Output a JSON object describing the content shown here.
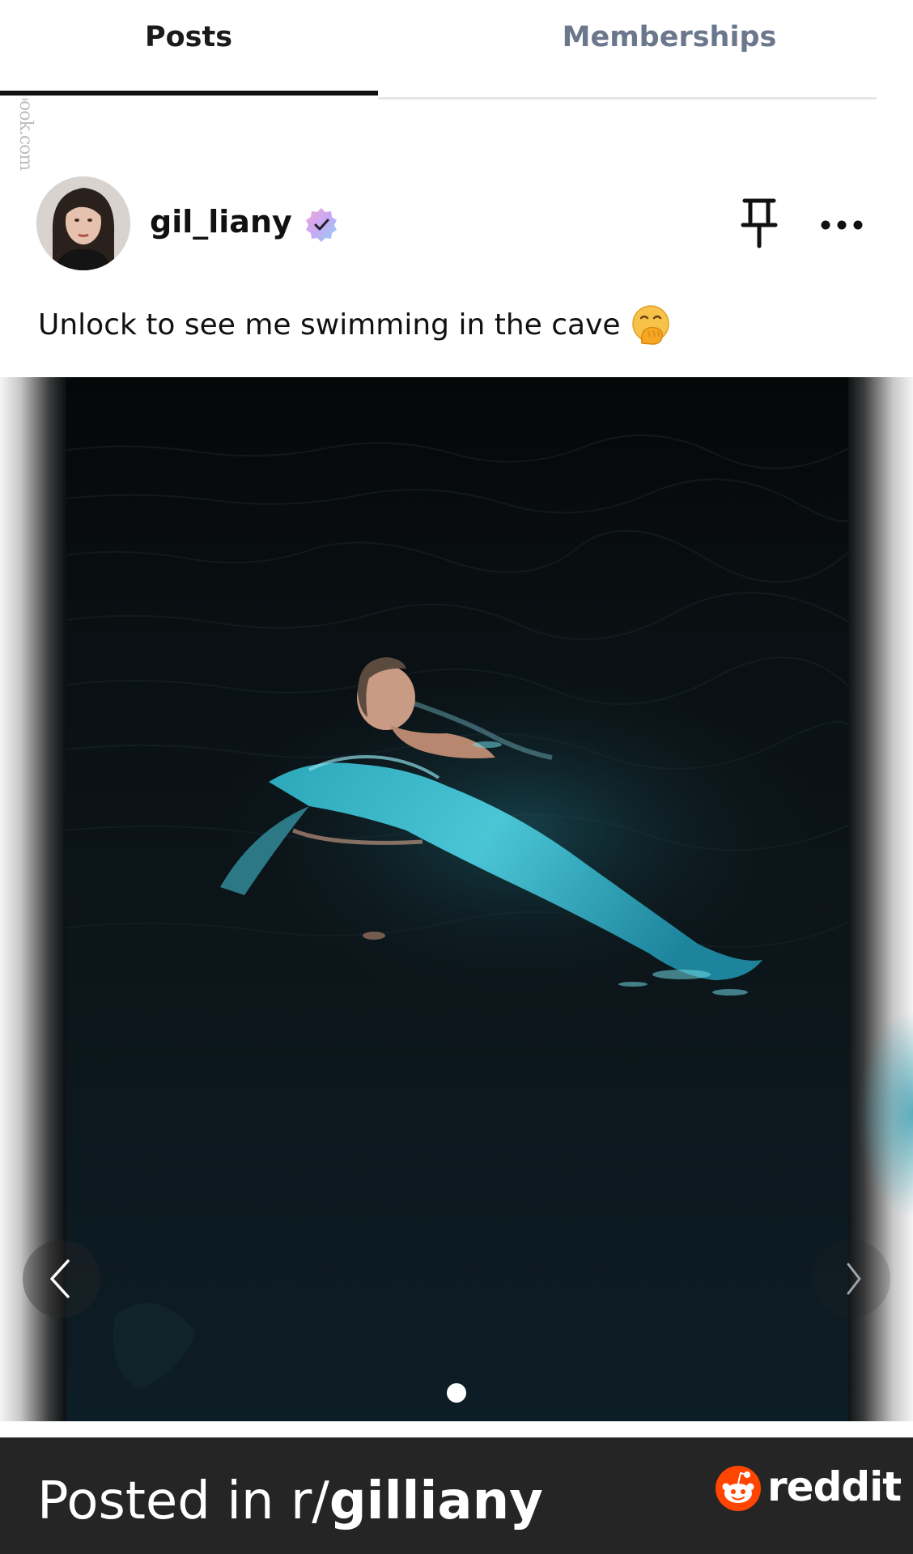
{
  "watermark": "fappeningbook.com",
  "tabs": [
    {
      "label": "Posts",
      "active": true
    },
    {
      "label": "Memberships",
      "active": false
    }
  ],
  "post": {
    "username": "gil_liany",
    "verified": true,
    "caption": "Unlock to see me swimming in the cave",
    "caption_emoji": "face-with-hand-over-mouth",
    "carousel": {
      "current_page": 1,
      "total_pages": 1
    }
  },
  "footer": {
    "posted_prefix": "Posted in r/",
    "subreddit": "gilliany",
    "brand": "reddit"
  },
  "colors": {
    "active_tab_text": "#1b1b1b",
    "inactive_tab_text": "#6b778c",
    "footer_bg": "#252525",
    "reddit_orange": "#ff4500"
  }
}
